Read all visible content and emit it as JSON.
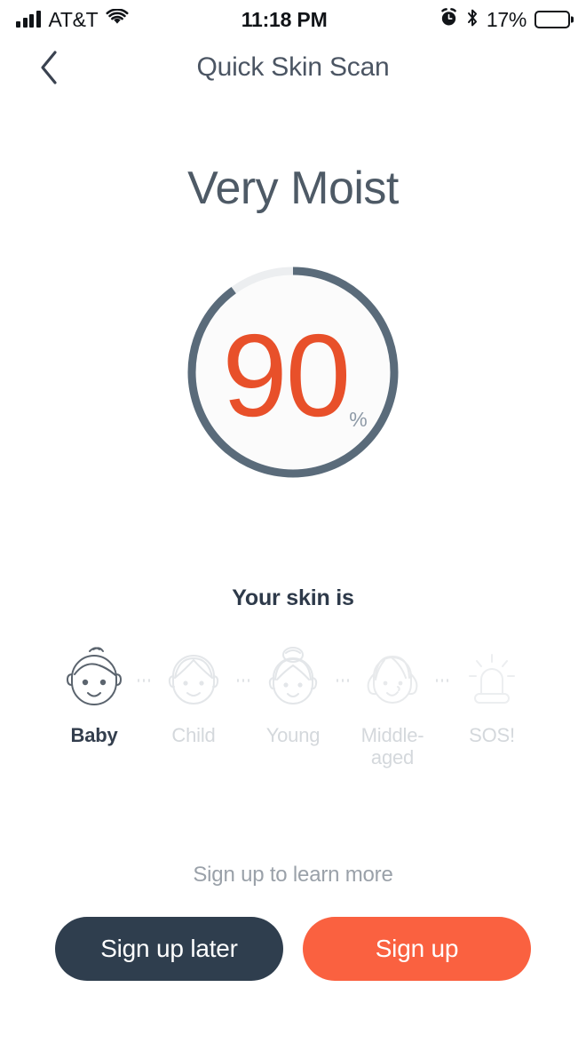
{
  "status_bar": {
    "carrier": "AT&T",
    "time": "11:18 PM",
    "battery_percent": "17%",
    "battery_level": 17,
    "icons": {
      "signal": "signal-bars-icon",
      "wifi": "wifi-icon",
      "alarm": "alarm-clock-icon",
      "bluetooth": "bluetooth-icon",
      "battery": "battery-icon"
    }
  },
  "nav": {
    "title": "Quick Skin Scan",
    "back_icon": "chevron-left-icon"
  },
  "result": {
    "headline": "Very Moist",
    "gauge": {
      "value": "90",
      "unit": "%",
      "percent": 90,
      "track_color": "#eceef0",
      "progress_color": "#5a6b7a",
      "value_color": "#e8502a",
      "unit_color": "#8d99a6"
    }
  },
  "skin": {
    "label": "Your skin is",
    "stages": [
      {
        "label": "Baby",
        "icon": "face-baby-icon",
        "active": true
      },
      {
        "label": "Child",
        "icon": "face-child-icon",
        "active": false
      },
      {
        "label": "Young",
        "icon": "face-young-icon",
        "active": false
      },
      {
        "label": "Middle-aged",
        "icon": "face-middle-aged-icon",
        "active": false
      },
      {
        "label": "SOS!",
        "icon": "siren-icon",
        "active": false
      }
    ]
  },
  "footer": {
    "hint": "Sign up to learn more",
    "secondary_button": "Sign up later",
    "primary_button": "Sign up",
    "secondary_color": "#2f3e4e",
    "primary_color": "#fa6140"
  }
}
